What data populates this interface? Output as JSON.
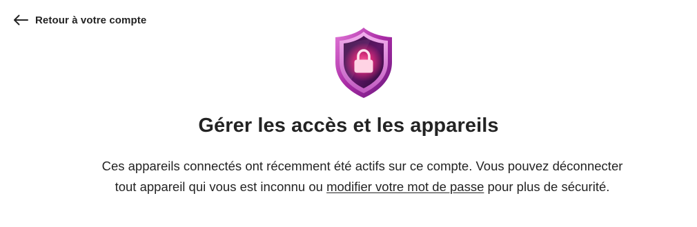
{
  "nav": {
    "back_label": "Retour à votre compte",
    "back_icon": "arrow-left-icon"
  },
  "hero": {
    "icon": "shield-lock-icon",
    "colors": {
      "outer": "#a02a9e",
      "inner": "#e08bd8",
      "glow": "#ff3d8a"
    }
  },
  "main": {
    "title": "Gérer les accès et les appareils",
    "description_before": "Ces appareils connectés ont récemment été actifs sur ce compte. Vous pouvez déconnecter tout appareil qui vous est inconnu ou ",
    "description_link": "modifier votre mot de passe",
    "description_after": " pour plus de sécurité."
  }
}
